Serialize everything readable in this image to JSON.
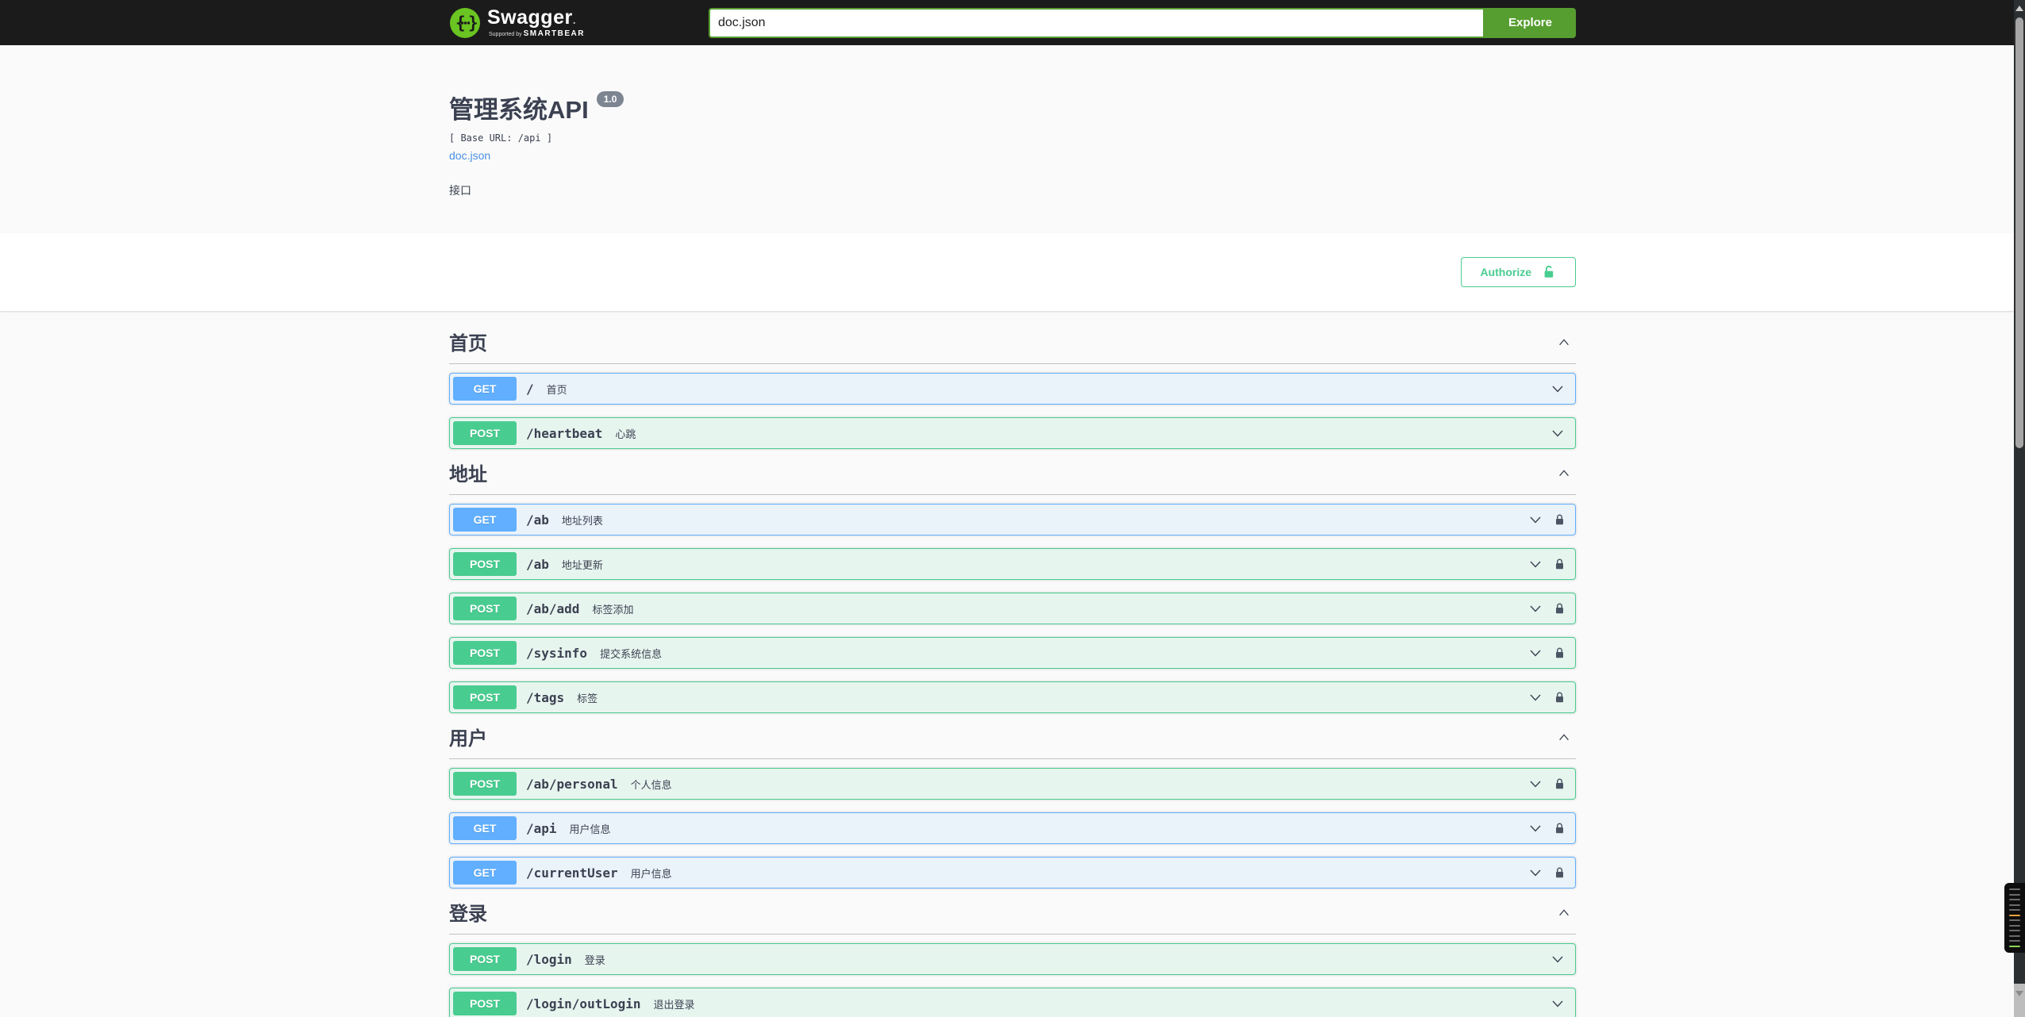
{
  "topbar": {
    "brand": "Swagger",
    "brand_mark": ".",
    "supported_by": "Supported by",
    "smartbear": "SMARTBEAR",
    "search_value": "doc.json",
    "explore_label": "Explore"
  },
  "info": {
    "title": "管理系统API",
    "version": "1.0",
    "base_url_label": "[ Base URL: /api ]",
    "spec_link": "doc.json",
    "description": "接口"
  },
  "auth": {
    "authorize_label": "Authorize"
  },
  "colors": {
    "topbar_bg": "#1b1b1b",
    "brand_green": "#6ac421",
    "explore_green": "#569e30",
    "get_blue": "#61affe",
    "post_green": "#49cc90",
    "authorize_green": "#49cc90",
    "link_blue": "#4990e2",
    "text": "#3b4151"
  },
  "icons": {
    "logo": "swagger-logo-icon",
    "unlock": "unlock-icon",
    "lock": "lock-icon",
    "chevron_up": "chevron-up-icon",
    "chevron_down": "chevron-down-icon"
  },
  "sections": [
    {
      "title": "首页",
      "expanded": true,
      "endpoints": [
        {
          "method": "GET",
          "path": "/",
          "summary": "首页",
          "locked": false
        },
        {
          "method": "POST",
          "path": "/heartbeat",
          "summary": "心跳",
          "locked": false
        }
      ]
    },
    {
      "title": "地址",
      "expanded": true,
      "endpoints": [
        {
          "method": "GET",
          "path": "/ab",
          "summary": "地址列表",
          "locked": true
        },
        {
          "method": "POST",
          "path": "/ab",
          "summary": "地址更新",
          "locked": true
        },
        {
          "method": "POST",
          "path": "/ab/add",
          "summary": "标签添加",
          "locked": true
        },
        {
          "method": "POST",
          "path": "/sysinfo",
          "summary": "提交系统信息",
          "locked": true
        },
        {
          "method": "POST",
          "path": "/tags",
          "summary": "标签",
          "locked": true
        }
      ]
    },
    {
      "title": "用户",
      "expanded": true,
      "endpoints": [
        {
          "method": "POST",
          "path": "/ab/personal",
          "summary": "个人信息",
          "locked": true
        },
        {
          "method": "GET",
          "path": "/api",
          "summary": "用户信息",
          "locked": true
        },
        {
          "method": "GET",
          "path": "/currentUser",
          "summary": "用户信息",
          "locked": true
        }
      ]
    },
    {
      "title": "登录",
      "expanded": true,
      "endpoints": [
        {
          "method": "POST",
          "path": "/login",
          "summary": "登录",
          "locked": false
        },
        {
          "method": "POST",
          "path": "/login/outLogin",
          "summary": "退出登录",
          "locked": false,
          "partial": true
        }
      ]
    }
  ]
}
